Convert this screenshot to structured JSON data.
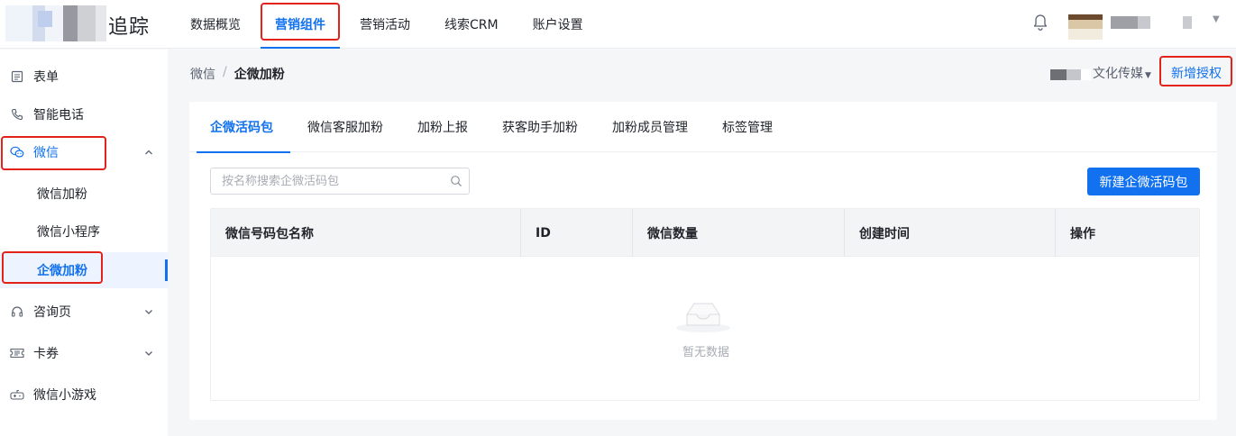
{
  "header": {
    "logo_text": "追踪",
    "nav": [
      {
        "label": "数据概览",
        "active": false
      },
      {
        "label": "营销组件",
        "active": true
      },
      {
        "label": "营销活动",
        "active": false
      },
      {
        "label": "线索CRM",
        "active": false
      },
      {
        "label": "账户设置",
        "active": false
      }
    ]
  },
  "sidebar": {
    "items": [
      {
        "label": "表单",
        "icon": "form-icon"
      },
      {
        "label": "智能电话",
        "icon": "phone-icon"
      },
      {
        "label": "微信",
        "icon": "wechat-icon",
        "expanded": true
      },
      {
        "label": "微信加粉"
      },
      {
        "label": "微信小程序"
      },
      {
        "label": "企微加粉",
        "active": true
      },
      {
        "label": "咨询页",
        "icon": "headset-icon"
      },
      {
        "label": "卡券",
        "icon": "ticket-icon"
      },
      {
        "label": "微信小游戏",
        "icon": "game-icon"
      }
    ]
  },
  "breadcrumb": {
    "parent": "微信",
    "separator": "/",
    "current": "企微加粉"
  },
  "account": {
    "name": "文化传媒",
    "new_auth_label": "新增授权"
  },
  "tabs": [
    {
      "label": "企微活码包",
      "active": true
    },
    {
      "label": "微信客服加粉"
    },
    {
      "label": "加粉上报"
    },
    {
      "label": "获客助手加粉"
    },
    {
      "label": "加粉成员管理"
    },
    {
      "label": "标签管理"
    }
  ],
  "search": {
    "placeholder": "按名称搜索企微活码包",
    "value": ""
  },
  "create_button_label": "新建企微活码包",
  "table": {
    "columns": [
      "微信号码包名称",
      "ID",
      "微信数量",
      "创建时间",
      "操作"
    ],
    "rows": [],
    "empty_text": "暂无数据"
  },
  "colors": {
    "accent": "#1171ee",
    "highlight": "#e2231a"
  }
}
